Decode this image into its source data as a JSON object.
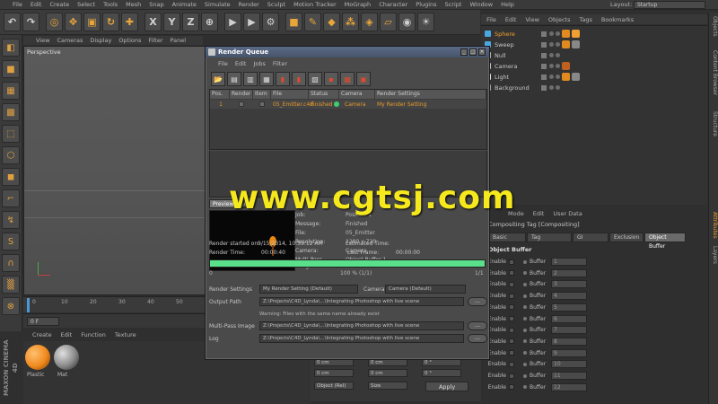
{
  "menubar": {
    "items": [
      "File",
      "Edit",
      "Create",
      "Select",
      "Tools",
      "Mesh",
      "Snap",
      "Animate",
      "Simulate",
      "Render",
      "Sculpt",
      "Motion Tracker",
      "MoGraph",
      "Character",
      "Plugins",
      "Script",
      "Window",
      "Help"
    ],
    "layout_label": "Layout:",
    "layout_value": "Startup"
  },
  "toolbar": {
    "axis_x": "X",
    "axis_y": "Y",
    "axis_z": "Z"
  },
  "viewport": {
    "menu": [
      "View",
      "Cameras",
      "Display",
      "Options",
      "Filter",
      "Panel"
    ],
    "label": "Perspective"
  },
  "timeline": {
    "ticks": [
      "0",
      "10",
      "20",
      "30",
      "40",
      "50",
      "60",
      "70",
      "80",
      "90"
    ],
    "frame": "0 F"
  },
  "materials": {
    "menu": [
      "Create",
      "Edit",
      "Function",
      "Texture"
    ],
    "items": [
      {
        "name": "Plastic",
        "color": "#f08a1e"
      },
      {
        "name": "Mat",
        "color": "#888888"
      }
    ]
  },
  "brand": {
    "maxon": "MAXON CINEMA 4D"
  },
  "coords": {
    "fields": [
      "0 cm",
      "0 cm",
      "0 °",
      "0 cm",
      "0 cm",
      "0 °",
      "0 cm",
      "0 cm",
      "0 °"
    ],
    "mode": "Object (Rel)",
    "size": "Size",
    "apply": "Apply"
  },
  "object_manager": {
    "menu": [
      "File",
      "Edit",
      "View",
      "Objects",
      "Tags",
      "Bookmarks"
    ],
    "objects": [
      {
        "name": "Sphere",
        "highlight": true,
        "icon_color": "#4aa8e0"
      },
      {
        "name": "Sweep",
        "highlight": false,
        "icon_color": "#4aa8e0"
      },
      {
        "name": "Null",
        "highlight": false,
        "icon_color": "#b0b0b0"
      },
      {
        "name": "Camera",
        "highlight": false,
        "icon_color": "#c0c0c0"
      },
      {
        "name": "Light",
        "highlight": false,
        "icon_color": "#e0e0e0"
      },
      {
        "name": "Background",
        "highlight": false,
        "icon_color": "#9aa0a8"
      }
    ]
  },
  "side_tabs": [
    "Objects",
    "Content Browser",
    "Structure",
    "Attributes",
    "Layers"
  ],
  "attributes": {
    "menu": [
      "Mode",
      "Edit",
      "User Data"
    ],
    "title": "Compositing Tag [Compositing]",
    "tabs": [
      "Basic",
      "Tag",
      "GI",
      "Exclusion",
      "Object Buffer"
    ],
    "section": "Object Buffer",
    "enable_label": "Enable",
    "buffer_label": "Buffer",
    "buffer_values": [
      "1",
      "2",
      "3",
      "4",
      "5",
      "6",
      "7",
      "8",
      "9",
      "10",
      "11",
      "12"
    ]
  },
  "render_queue": {
    "title": "Render Queue",
    "menu": [
      "File",
      "Edit",
      "Jobs",
      "Filter"
    ],
    "columns": [
      "Pos.",
      "Render",
      "Item",
      "File",
      "Status",
      "Camera",
      "Render Settings"
    ],
    "job": {
      "pos": "1",
      "file": "05_Emitter.c4d",
      "status": "Finished",
      "camera": "Camera",
      "settings": "My Render Setting"
    },
    "preview_tabs": [
      "Preview",
      "Log"
    ],
    "info_labels": [
      "Job:",
      "Message:",
      "File:",
      "Resolution:",
      "Camera:",
      "Multi-Pass Image:"
    ],
    "info_values": [
      "Position 1",
      "Finished",
      "05_Emitter",
      "1280 x 720",
      "Camera",
      "Object Buffer 1"
    ],
    "render_started_label": "Render started on:",
    "render_started": "9/15/2014, 10:59:12 AM",
    "estimated_label": "Estimated Time:",
    "render_time_label": "Render Time:",
    "render_time": "00:00:40",
    "last_frame_label": "Last Frame:",
    "last_frame": "00:00:00",
    "progress": 1.0,
    "progress_start": "0",
    "progress_mid": "100 % (1/1)",
    "progress_end": "1/1",
    "render_settings_label": "Render Settings",
    "render_settings": "My Render Setting (Default)",
    "camera_label": "Camera",
    "camera": "Camera (Default)",
    "output_label": "Output Path",
    "output_path": "Z:\\Projects\\C4D_Lynda\\...\\Integrating Photoshop with live scene",
    "warning": "Warning: Files with the same name already exist",
    "multipass_label": "Multi-Pass Image",
    "multipass_path": "Z:\\Projects\\C4D_Lynda\\...\\Integrating Photoshop with live scene",
    "log_label": "Log",
    "log_path": "Z:\\Projects\\C4D_Lynda\\...\\Integrating Photoshop with live scene",
    "browse": "..."
  },
  "watermark": "www.cgtsj.com"
}
